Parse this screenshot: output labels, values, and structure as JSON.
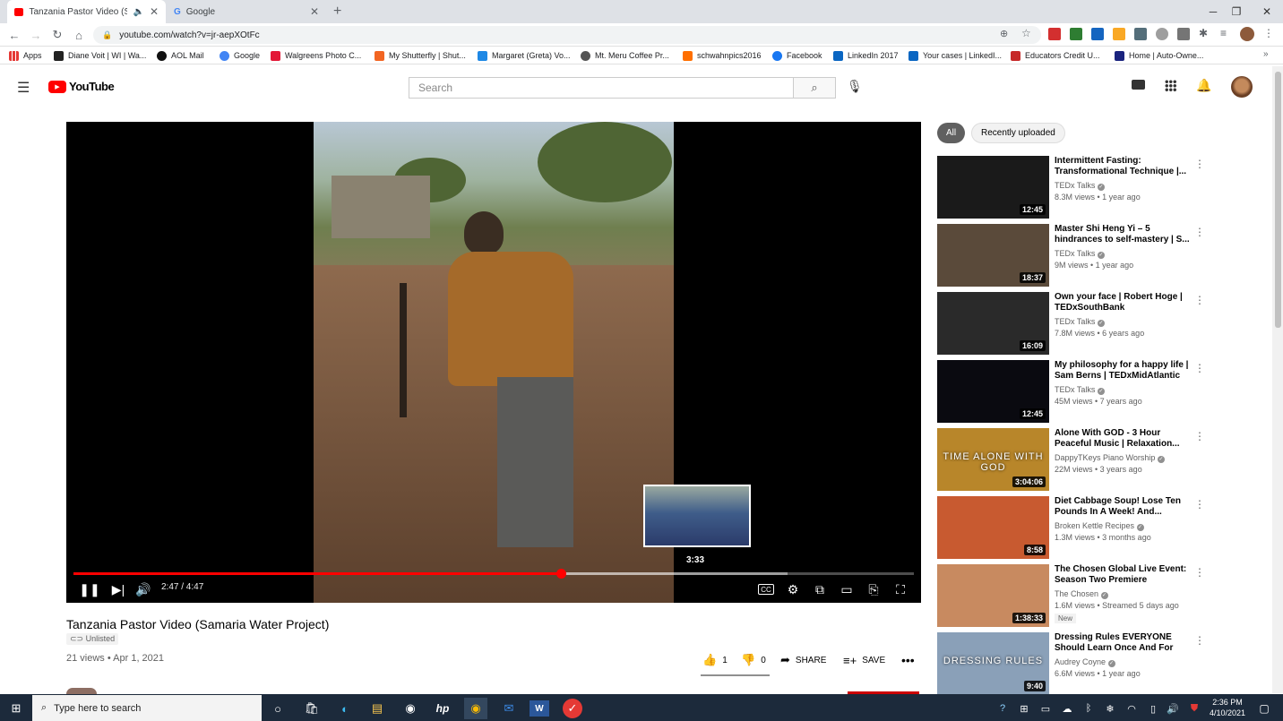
{
  "browser": {
    "tabs": [
      {
        "label": "Tanzania Pastor Video (Sama"
      },
      {
        "label": "Google"
      }
    ],
    "url": "youtube.com/watch?v=jr-aepXOtFc",
    "bookmarks": [
      "Apps",
      "Diane Voit | WI | Wa...",
      "AOL Mail",
      "Google",
      "Walgreens Photo C...",
      "My Shutterfly | Shut...",
      "Margaret (Greta) Vo...",
      "Mt. Meru Coffee Pr...",
      "schwahnpics2016",
      "Facebook",
      "LinkedIn 2017",
      "Your cases | LinkedI...",
      "Educators Credit U...",
      "Home | Auto-Owne..."
    ]
  },
  "yt": {
    "logo": "YouTube",
    "search_placeholder": "Search"
  },
  "player": {
    "time": "2:47 / 4:47",
    "hover_time": "3:33",
    "progress": 0.58,
    "buffered": 0.85
  },
  "video": {
    "title": "Tanzania Pastor Video (Samaria Water Project)",
    "visibility": "Unlisted",
    "meta": "21 views • Apr 1, 2021",
    "likes": "1",
    "dislikes": "0",
    "share": "SHARE",
    "save": "SAVE"
  },
  "chips": [
    "All",
    "Recently uploaded"
  ],
  "recommendations": [
    {
      "title": "Intermittent Fasting: Transformational Technique |...",
      "channel": "TEDx Talks",
      "views": "8.3M views • 1 year ago",
      "duration": "12:45",
      "color": "#1a1a1a"
    },
    {
      "title": "Master Shi Heng Yi – 5 hindrances to self-mastery | S...",
      "channel": "TEDx Talks",
      "views": "9M views • 1 year ago",
      "duration": "18:37",
      "color": "#5a4a3a"
    },
    {
      "title": "Own your face | Robert Hoge | TEDxSouthBank",
      "channel": "TEDx Talks",
      "views": "7.8M views • 6 years ago",
      "duration": "16:09",
      "color": "#2a2a2a"
    },
    {
      "title": "My philosophy for a happy life | Sam Berns | TEDxMidAtlantic",
      "channel": "TEDx Talks",
      "views": "45M views • 7 years ago",
      "duration": "12:45",
      "color": "#0a0a10"
    },
    {
      "title": "Alone With GOD - 3 Hour Peaceful Music | Relaxation...",
      "channel": "DappyTKeys Piano Worship",
      "views": "22M views • 3 years ago",
      "duration": "3:04:06",
      "color": "#b8862a",
      "overlay": "TIME ALONE WITH GOD"
    },
    {
      "title": "Diet Cabbage Soup! Lose Ten Pounds In A Week! And...",
      "channel": "Broken Kettle Recipes",
      "views": "1.3M views • 3 months ago",
      "duration": "8:58",
      "color": "#c85a30"
    },
    {
      "title": "The Chosen Global Live Event: Season Two Premiere",
      "channel": "The Chosen",
      "views": "1.6M views • Streamed 5 days ago",
      "duration": "1:38:33",
      "color": "#c88a60",
      "badge": "New"
    },
    {
      "title": "Dressing Rules EVERYONE Should Learn Once And For ALL",
      "channel": "Audrey Coyne",
      "views": "6.6M views • 1 year ago",
      "duration": "9:40",
      "color": "#8aa0b8",
      "overlay": "DRESSING RULES"
    }
  ],
  "taskbar": {
    "search_placeholder": "Type here to search",
    "time": "2:36 PM",
    "date": "4/10/2021"
  }
}
